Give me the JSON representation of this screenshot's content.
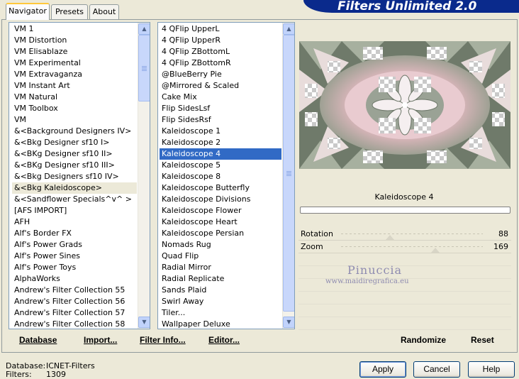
{
  "banner": "Filters Unlimited 2.0",
  "tabs": [
    "Navigator",
    "Presets",
    "About"
  ],
  "categories": [
    "VM 1",
    "VM Distortion",
    "VM Elisablaze",
    "VM Experimental",
    "VM Extravaganza",
    "VM Instant Art",
    "VM Natural",
    "VM Toolbox",
    "VM",
    "&<Background Designers IV>",
    "&<Bkg Designer sf10 I>",
    "&<BKg Designer sf10 II>",
    "&<BKg Designer sf10 III>",
    "&<Bkg Designers sf10 IV>",
    "&<Bkg Kaleidoscope>",
    "&<Sandflower Specials^v^ >",
    "[AFS IMPORT]",
    "AFH",
    "Alf's Border FX",
    "Alf's Power Grads",
    "Alf's Power Sines",
    "Alf's Power Toys",
    "AlphaWorks",
    "Andrew's Filter Collection 55",
    "Andrew's Filter Collection 56",
    "Andrew's Filter Collection 57",
    "Andrew's Filter Collection 58"
  ],
  "filters": [
    "4 QFlip UpperL",
    "4 QFlip UpperR",
    "4 QFlip ZBottomL",
    "4 QFlip ZBottomR",
    "@BlueBerry Pie",
    "@Mirrored & Scaled",
    "Cake Mix",
    "Flip SidesLsf",
    "Flip SidesRsf",
    "Kaleidoscope 1",
    "Kaleidoscope 2",
    "Kaleidoscope 4",
    "Kaleidoscope 5",
    "Kaleidoscope 8",
    "Kaleidoscope Butterfly",
    "Kaleidoscope Divisions",
    "Kaleidoscope Flower",
    "Kaleidoscope Heart",
    "Kaleidoscope Persian",
    "Nomads Rug",
    "Quad Flip",
    "Radial Mirror",
    "Radial Replicate",
    "Sands Plaid",
    "Swirl Away",
    "Tiler...",
    "Wallpaper Deluxe"
  ],
  "selected_category": "&<Bkg Kaleidoscope>",
  "selected_filter": "Kaleidoscope 4",
  "list_buttons": {
    "database": "Database",
    "import": "Import...",
    "filter_info": "Filter Info...",
    "editor": "Editor..."
  },
  "filter_title": "Kaleidoscope 4",
  "params": [
    {
      "label": "Rotation",
      "value": "88",
      "level": 0.345
    },
    {
      "label": "Zoom",
      "value": "169",
      "level": 0.663
    }
  ],
  "watermark": {
    "line1": "Pinuccia",
    "line2": "www.maidiregrafica.eu"
  },
  "right_buttons": {
    "randomize": "Randomize",
    "reset": "Reset"
  },
  "footer": {
    "database_label": "Database:",
    "database_value": "ICNET-Filters",
    "filters_label": "Filters:",
    "filters_value": "1309"
  },
  "dialog_buttons": {
    "apply": "Apply",
    "cancel": "Cancel",
    "help": "Help"
  },
  "colors": {
    "selection": "#316ac5",
    "banner": "#0a2a8c"
  }
}
